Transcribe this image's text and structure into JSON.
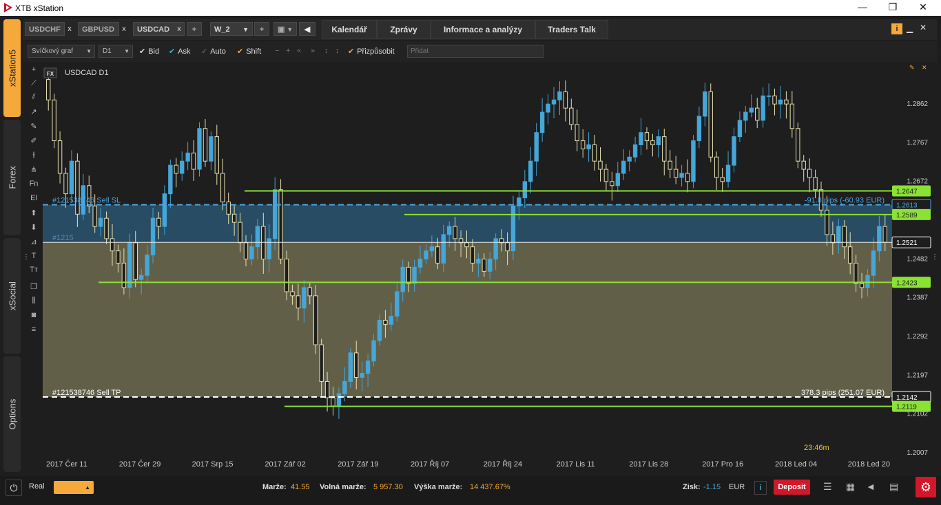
{
  "window": {
    "title": "XTB xStation",
    "minimize": "—",
    "maximize": "❐",
    "close": "✕"
  },
  "sidenav": {
    "xstation": "xStation5",
    "forex": "Forex",
    "xsocial": "xSocial",
    "options": "Options"
  },
  "tabs": {
    "symbols": [
      "USDCHF",
      "GBPUSD",
      "USDCAD"
    ],
    "close_glyph": "x",
    "add": "+",
    "workspace": "W_2",
    "workspace_add": "+",
    "nav": [
      "Kalendář",
      "Zprávy",
      "Informace a analýzy",
      "Traders Talk"
    ]
  },
  "toolbar": {
    "chart_type": "Svíčkový graf",
    "interval": "D1",
    "bid": "Bid",
    "ask": "Ask",
    "auto": "Auto",
    "shift": "Shift",
    "customize": "Přizpůsobit",
    "add_placeholder": "Přidat"
  },
  "chart": {
    "badge": "FX",
    "title": "USDCAD D1",
    "timer": "23:46m",
    "sl_label": "#121538746 Sell  SL",
    "sl_info": "-91.8 pips (-60.93 EUR)",
    "entry_label": "#1215",
    "tp_label": "#121538746 Sell  TP",
    "tp_info": "378.3 pips (251.07 EUR)",
    "colors": {
      "bull": "#45a6d8",
      "bear_fill": "#1e1e1e",
      "bear_stroke": "#e6e0b0",
      "hline": "#8ae234",
      "sl": "#4aa3e0",
      "tp": "#ffffff"
    }
  },
  "chart_data": {
    "type": "candlestick",
    "instrument": "USDCAD",
    "interval": "D1",
    "ylim": [
      1.2007,
      1.294
    ],
    "y_ticks": [
      "1.2862",
      "1.2767",
      "1.2672",
      "1.2482",
      "1.2387",
      "1.2292",
      "1.2197",
      "1.2102",
      "1.2007"
    ],
    "x_ticks": [
      "2017 Čer 11",
      "2017 Čer 29",
      "2017 Srp 15",
      "2017 Zář 02",
      "2017 Zář 19",
      "2017 Říj 07",
      "2017 Říj 24",
      "2017 Lis 11",
      "2017 Lis 28",
      "2017 Pro 16",
      "2018 Led 04",
      "2018 Led 20"
    ],
    "price_tags": {
      "h1": "1.2647",
      "sl": "1.2613",
      "h2": "1.2589",
      "current": "1.2521",
      "h3": "1.2423",
      "tp": "1.2142",
      "h4": "1.2119"
    },
    "levels": {
      "h1": 1.2647,
      "sl": 1.2613,
      "h2": 1.2589,
      "current": 1.2521,
      "h3": 1.2423,
      "tp": 1.2142,
      "h4": 1.2119
    },
    "closes": [
      1.287,
      1.277,
      1.269,
      1.264,
      1.272,
      1.259,
      1.266,
      1.261,
      1.256,
      1.258,
      1.253,
      1.25,
      1.247,
      1.241,
      1.252,
      1.243,
      1.244,
      1.249,
      1.258,
      1.256,
      1.264,
      1.271,
      1.269,
      1.272,
      1.274,
      1.27,
      1.28,
      1.272,
      1.278,
      1.269,
      1.262,
      1.259,
      1.257,
      1.252,
      1.248,
      1.251,
      1.256,
      1.248,
      1.253,
      1.265,
      1.248,
      1.24,
      1.239,
      1.236,
      1.241,
      1.239,
      1.227,
      1.218,
      1.214,
      1.212,
      1.215,
      1.218,
      1.225,
      1.219,
      1.22,
      1.223,
      1.228,
      1.233,
      1.232,
      1.234,
      1.24,
      1.246,
      1.242,
      1.246,
      1.248,
      1.25,
      1.251,
      1.247,
      1.254,
      1.256,
      1.253,
      1.252,
      1.251,
      1.247,
      1.248,
      1.245,
      1.248,
      1.253,
      1.252,
      1.25,
      1.261,
      1.263,
      1.267,
      1.272,
      1.279,
      1.284,
      1.286,
      1.287,
      1.289,
      1.285,
      1.281,
      1.277,
      1.275,
      1.276,
      1.272,
      1.27,
      1.267,
      1.266,
      1.269,
      1.272,
      1.273,
      1.276,
      1.279,
      1.277,
      1.276,
      1.278,
      1.272,
      1.27,
      1.268,
      1.269,
      1.267,
      1.277,
      1.283,
      1.289,
      1.273,
      1.268,
      1.267,
      1.271,
      1.278,
      1.282,
      1.284,
      1.285,
      1.282,
      1.288,
      1.288,
      1.286,
      1.287,
      1.286,
      1.28,
      1.272,
      1.27,
      1.268,
      1.265,
      1.26,
      1.254,
      1.252,
      1.256,
      1.251,
      1.247,
      1.242,
      1.241,
      1.244,
      1.25,
      1.256,
      1.2521
    ]
  },
  "bottom": {
    "account_type": "Real",
    "margin_label": "Marže:",
    "margin_value": "41.55",
    "free_margin_label": "Volná marže:",
    "free_margin_value": "5 957.30",
    "margin_level_label": "Výška marže:",
    "margin_level_value": "14 437.67%",
    "profit_label": "Zisk:",
    "profit_value": "-1.15",
    "currency": "EUR",
    "deposit": "Deposit"
  }
}
